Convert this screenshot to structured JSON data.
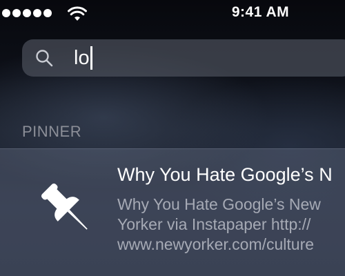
{
  "status_bar": {
    "time": "9:41 AM",
    "signal_bars": 5,
    "icons": [
      "signal-dots",
      "wifi-icon"
    ]
  },
  "search": {
    "value": "lo",
    "icon": "search-icon"
  },
  "results": {
    "section_label": "PINNER",
    "items": [
      {
        "title": "Why You Hate Google’s N",
        "description_lines": [
          "Why You Hate Google’s New",
          "Yorker via Instapaper http://",
          "www.newyorker.com/culture"
        ],
        "icon": "pushpin-icon"
      }
    ]
  },
  "colors": {
    "text_primary": "#ffffff",
    "text_secondary": "#a6aab5",
    "section_label": "#8c8f98",
    "search_field": "#545864"
  }
}
